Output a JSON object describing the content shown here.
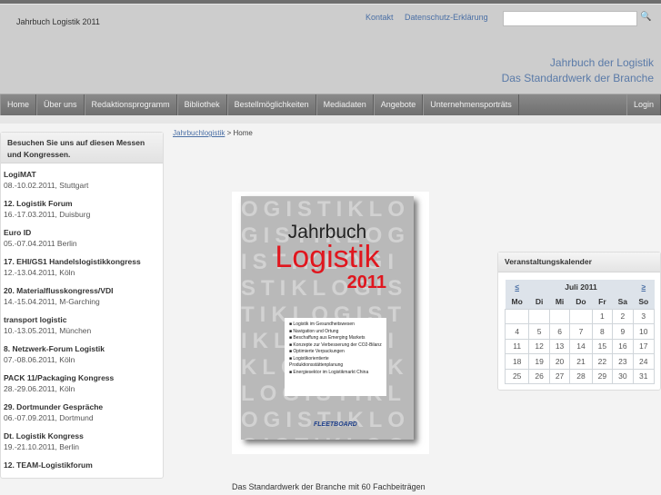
{
  "header": {
    "site_title": "Jahrbuch Logistik 2011",
    "links": [
      "Kontakt",
      "Datenschutz-Erklärung"
    ],
    "search_placeholder": "",
    "tagline1": "Jahrbuch der Logistik",
    "tagline2": "Das Standardwerk der Branche"
  },
  "nav": {
    "items": [
      "Home",
      "Über uns",
      "Redaktionsprogramm",
      "Bibliothek",
      "Bestellmöglichkeiten",
      "Mediadaten",
      "Angebote",
      "Unternehmensporträts"
    ],
    "login": "Login"
  },
  "sidebar": {
    "title": "Besuchen Sie uns auf diesen Messen und Kongressen.",
    "events": [
      {
        "name": "LogiMAT",
        "info": "08.-10.02.2011, Stuttgart"
      },
      {
        "name": "12. Logistik Forum",
        "info": "16.-17.03.2011, Duisburg"
      },
      {
        "name": "Euro ID",
        "info": "05.-07.04.2011 Berlin"
      },
      {
        "name": "17. EHI/GS1 Handelslogistikkongress",
        "info": "12.-13.04.2011, Köln"
      },
      {
        "name": "20. Materialflusskongress/VDI",
        "info": "14.-15.04.2011, M-Garching"
      },
      {
        "name": "transport logistic",
        "info": "10.-13.05.2011, München"
      },
      {
        "name": "8. Netzwerk-Forum Logistik",
        "info": "07.-08.06.2011, Köln"
      },
      {
        "name": "PACK 11/Packaging Kongress",
        "info": "28.-29.06.2011, Köln"
      },
      {
        "name": "29. Dortmunder Gespräche",
        "info": "06.-07.09.2011, Dortmund"
      },
      {
        "name": "Dt. Logistik Kongress",
        "info": "19.-21.10.2011, Berlin"
      },
      {
        "name": "12. TEAM-Logistikforum",
        "info": ""
      }
    ]
  },
  "breadcrumb": {
    "link": "Jahrbuchlogistik",
    "sep": " > ",
    "current": "Home"
  },
  "cover": {
    "title1": "Jahrbuch",
    "title2": "Logistik",
    "year": "2011",
    "bullets": [
      "Logistik im Gesundheitswesen",
      "Navigation und Ortung",
      "Beschaffung aus Emerging Markets",
      "Konzepte zur Verbesserung der CO2-Bilanz",
      "Optimierte Verpackungen",
      "Logistikorientierte Produktionsstättenplanung",
      "Energiesektor im Logistikmarkt China"
    ],
    "brand": "FLEETBOARD"
  },
  "caption": "Das Standardwerk der Branche mit 60 Fachbeiträgen",
  "calendar": {
    "title": "Veranstaltungskalender",
    "prev": "≤",
    "next": "≥",
    "month": "Juli 2011",
    "weekdays": [
      "Mo",
      "Di",
      "Mi",
      "Do",
      "Fr",
      "Sa",
      "So"
    ],
    "weeks": [
      [
        "",
        "",
        "",
        "",
        "1",
        "2",
        "3"
      ],
      [
        "4",
        "5",
        "6",
        "7",
        "8",
        "9",
        "10"
      ],
      [
        "11",
        "12",
        "13",
        "14",
        "15",
        "16",
        "17"
      ],
      [
        "18",
        "19",
        "20",
        "21",
        "22",
        "23",
        "24"
      ],
      [
        "25",
        "26",
        "27",
        "28",
        "29",
        "30",
        "31"
      ]
    ]
  }
}
